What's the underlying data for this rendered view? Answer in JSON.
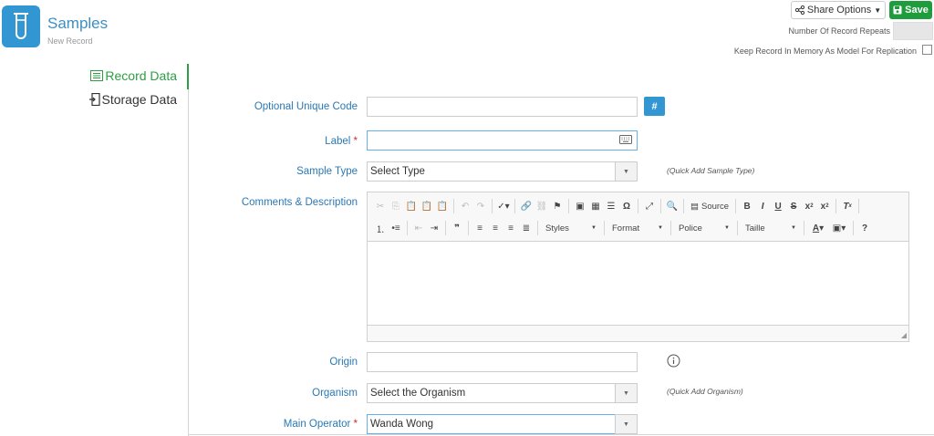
{
  "header": {
    "title": "Samples",
    "subtitle": "New Record",
    "share_label": "Share Options",
    "save_label": "Save",
    "repeats_label": "Number Of Record Repeats",
    "repeats_value": "",
    "memory_label": "Keep Record In Memory As Model For Replication",
    "memory_checked": false
  },
  "nav": {
    "items": [
      {
        "label": "Record Data",
        "active": true
      },
      {
        "label": "Storage Data",
        "active": false
      }
    ]
  },
  "form": {
    "unique_code": {
      "label": "Optional Unique Code",
      "value": "",
      "button": "#"
    },
    "label_field": {
      "label": "Label",
      "value": "",
      "required": true
    },
    "sample_type": {
      "label": "Sample Type",
      "value": "Select Type",
      "quick_add": "(Quick Add Sample Type)"
    },
    "comments": {
      "label": "Comments & Description"
    },
    "origin": {
      "label": "Origin",
      "value": ""
    },
    "organism": {
      "label": "Organism",
      "value": "Select the Organism",
      "quick_add": "(Quick Add Organism)"
    },
    "main_operator": {
      "label": "Main Operator",
      "value": "Wanda Wong",
      "required": true
    }
  },
  "editor": {
    "source_label": "Source",
    "styles_label": "Styles",
    "format_label": "Format",
    "font_label": "Police",
    "size_label": "Taille"
  },
  "colors": {
    "accent_blue": "#3296d3",
    "save_green": "#1f9d3c",
    "label_blue": "#2a78b4",
    "active_green": "#2c9e44",
    "required_red": "#d62828"
  }
}
